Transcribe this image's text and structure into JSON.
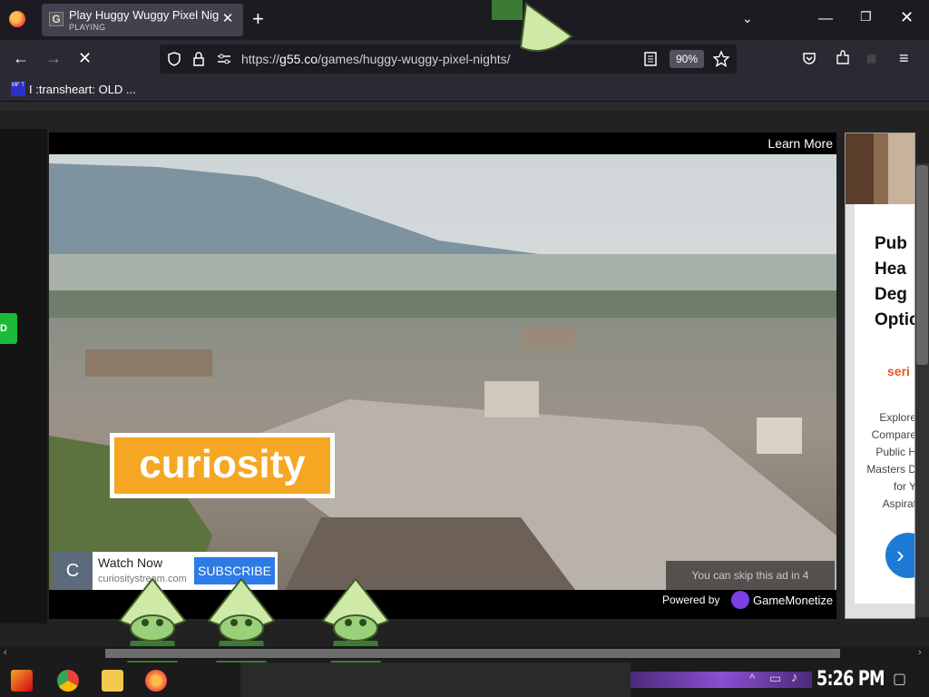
{
  "tab": {
    "title": "Play Huggy Wuggy Pixel Night",
    "status": "PLAYING",
    "close": "✕"
  },
  "window": {
    "new_tab": "+",
    "tab_list": "⌄",
    "minimize": "—",
    "maximize": "❐",
    "close": "✕"
  },
  "nav": {
    "back": "←",
    "forward": "→",
    "stop": "✕",
    "url_prefix": "https://",
    "url_domain": "g55.co",
    "url_path": "/games/huggy-wuggy-pixel-nights/",
    "zoom": "90%"
  },
  "bookmarks": {
    "item_icon_text": "MF T",
    "item_label": "I :transheart: OLD ..."
  },
  "page": {
    "left_button": "D"
  },
  "ad": {
    "learn_more": "Learn More",
    "brand": "curiosity",
    "channel_initial": "C",
    "channel_name": "Watch Now",
    "channel_url": "curiositystream.com",
    "subscribe": "SUBSCRIBE",
    "skip": "You can skip this ad in 4",
    "powered_by": "Powered by",
    "provider": "GameMonetize"
  },
  "side_ad": {
    "heading": "Pub\nHea\nDeg\nOptic",
    "brand": "seri",
    "body": "Explore\nCompare\nPublic H\nMasters D\nfor Y\nAspirat",
    "arrow": "›"
  },
  "taskbar": {
    "clock": "5:26 PM"
  }
}
